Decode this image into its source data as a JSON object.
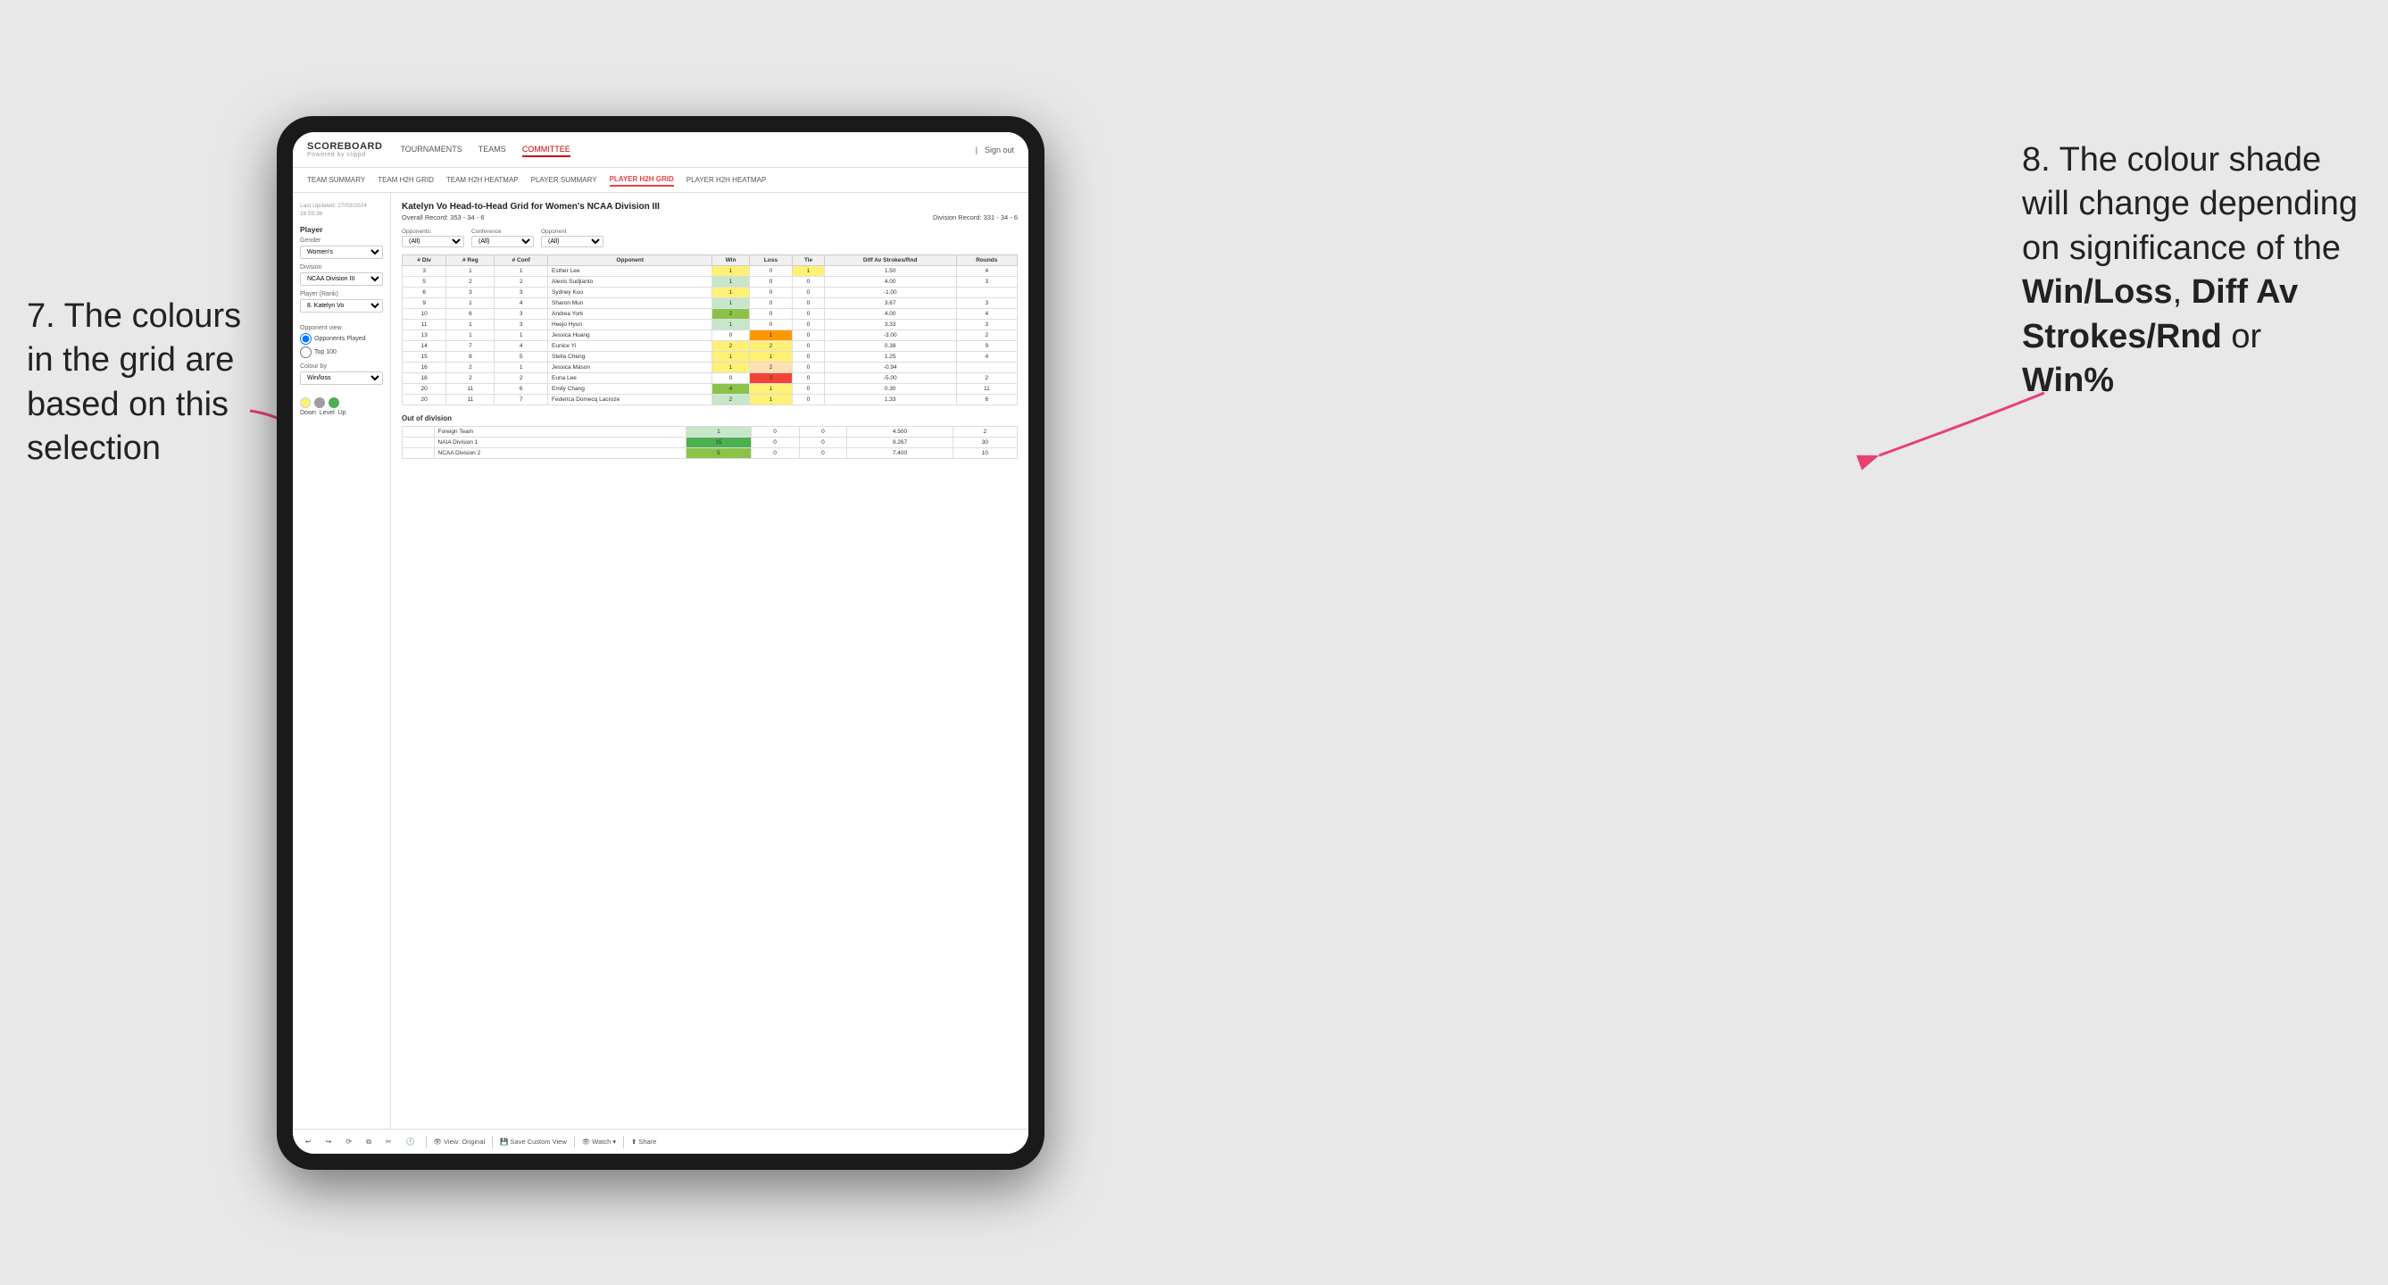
{
  "annotations": {
    "left_title": "7. The colours in the grid are based on this selection",
    "right_title": "8. The colour shade will change depending on significance of the",
    "right_bold1": "Win/Loss",
    "right_comma": ", ",
    "right_bold2": "Diff Av Strokes/Rnd",
    "right_or": " or",
    "right_bold3": "Win%"
  },
  "nav": {
    "logo": "SCOREBOARD",
    "logo_sub": "Powered by clippd",
    "links": [
      "TOURNAMENTS",
      "TEAMS",
      "COMMITTEE"
    ],
    "active_link": "COMMITTEE",
    "right": [
      "Sign out"
    ]
  },
  "subnav": {
    "links": [
      "TEAM SUMMARY",
      "TEAM H2H GRID",
      "TEAM H2H HEATMAP",
      "PLAYER SUMMARY",
      "PLAYER H2H GRID",
      "PLAYER H2H HEATMAP"
    ],
    "active": "PLAYER H2H GRID"
  },
  "sidebar": {
    "updated": "Last Updated: 27/03/2024\n16:55:38",
    "player_section": "Player",
    "gender_label": "Gender",
    "gender_value": "Women's",
    "division_label": "Division",
    "division_value": "NCAA Division III",
    "player_rank_label": "Player (Rank)",
    "player_rank_value": "8. Katelyn Vo",
    "opponent_view_label": "Opponent view",
    "radio_opponents": "Opponents Played",
    "radio_top100": "Top 100",
    "colour_by_label": "Colour by",
    "colour_by_value": "Win/loss",
    "legend_down": "Down",
    "legend_level": "Level",
    "legend_up": "Up"
  },
  "grid": {
    "title": "Katelyn Vo Head-to-Head Grid for Women's NCAA Division III",
    "overall_record": "Overall Record: 353 - 34 - 6",
    "division_record": "Division Record: 331 - 34 - 6",
    "filter_opponents_label": "Opponents:",
    "filter_opponents_value": "(All)",
    "filter_conference_label": "Conference",
    "filter_conference_value": "(All)",
    "filter_opponent_label": "Opponent",
    "filter_opponent_value": "(All)",
    "columns": [
      "# Div",
      "# Reg",
      "# Conf",
      "Opponent",
      "Win",
      "Loss",
      "Tie",
      "Diff Av Strokes/Rnd",
      "Rounds"
    ],
    "rows": [
      {
        "div": 3,
        "reg": 1,
        "conf": 1,
        "opponent": "Esther Lee",
        "win": 1,
        "loss": 0,
        "tie": 1,
        "diff": 1.5,
        "rounds": 4,
        "win_color": "cell-yellow",
        "loss_color": "cell-white",
        "tie_color": "cell-yellow"
      },
      {
        "div": 5,
        "reg": 2,
        "conf": 2,
        "opponent": "Alexis Sudjianto",
        "win": 1,
        "loss": 0,
        "tie": 0,
        "diff": 4.0,
        "rounds": 3,
        "win_color": "cell-green-light",
        "loss_color": "cell-white",
        "tie_color": "cell-white"
      },
      {
        "div": 6,
        "reg": 3,
        "conf": 3,
        "opponent": "Sydney Kuo",
        "win": 1,
        "loss": 0,
        "tie": 0,
        "diff": -1.0,
        "rounds": "",
        "win_color": "cell-yellow",
        "loss_color": "cell-white",
        "tie_color": "cell-white"
      },
      {
        "div": 9,
        "reg": 1,
        "conf": 4,
        "opponent": "Sharon Mun",
        "win": 1,
        "loss": 0,
        "tie": 0,
        "diff": 3.67,
        "rounds": 3,
        "win_color": "cell-green-light",
        "loss_color": "cell-white",
        "tie_color": "cell-white"
      },
      {
        "div": 10,
        "reg": 6,
        "conf": 3,
        "opponent": "Andrea York",
        "win": 2,
        "loss": 0,
        "tie": 0,
        "diff": 4.0,
        "rounds": 4,
        "win_color": "cell-green-med",
        "loss_color": "cell-white",
        "tie_color": "cell-white"
      },
      {
        "div": 11,
        "reg": 1,
        "conf": 3,
        "opponent": "Heejo Hyun",
        "win": 1,
        "loss": 0,
        "tie": 0,
        "diff": 3.33,
        "rounds": 3,
        "win_color": "cell-green-light",
        "loss_color": "cell-white",
        "tie_color": "cell-white"
      },
      {
        "div": 13,
        "reg": 1,
        "conf": 1,
        "opponent": "Jessica Huang",
        "win": 0,
        "loss": 1,
        "tie": 0,
        "diff": -3.0,
        "rounds": 2,
        "win_color": "cell-white",
        "loss_color": "cell-orange",
        "tie_color": "cell-white"
      },
      {
        "div": 14,
        "reg": 7,
        "conf": 4,
        "opponent": "Eunice Yi",
        "win": 2,
        "loss": 2,
        "tie": 0,
        "diff": 0.38,
        "rounds": 9,
        "win_color": "cell-yellow",
        "loss_color": "cell-yellow",
        "tie_color": "cell-white"
      },
      {
        "div": 15,
        "reg": 8,
        "conf": 5,
        "opponent": "Stella Cheng",
        "win": 1,
        "loss": 1,
        "tie": 0,
        "diff": 1.25,
        "rounds": 4,
        "win_color": "cell-yellow",
        "loss_color": "cell-yellow",
        "tie_color": "cell-white"
      },
      {
        "div": 16,
        "reg": 2,
        "conf": 1,
        "opponent": "Jessica Mason",
        "win": 1,
        "loss": 2,
        "tie": 0,
        "diff": -0.94,
        "rounds": "",
        "win_color": "cell-yellow",
        "loss_color": "cell-orange-light",
        "tie_color": "cell-white"
      },
      {
        "div": 18,
        "reg": 2,
        "conf": 2,
        "opponent": "Euna Lee",
        "win": 0,
        "loss": 3,
        "tie": 0,
        "diff": -5.0,
        "rounds": 2,
        "win_color": "cell-white",
        "loss_color": "cell-red",
        "tie_color": "cell-white"
      },
      {
        "div": 20,
        "reg": 11,
        "conf": 6,
        "opponent": "Emily Chang",
        "win": 4,
        "loss": 1,
        "tie": 0,
        "diff": 0.3,
        "rounds": 11,
        "win_color": "cell-green-med",
        "loss_color": "cell-yellow",
        "tie_color": "cell-white"
      },
      {
        "div": 20,
        "reg": 11,
        "conf": 7,
        "opponent": "Federica Domecq Lacroze",
        "win": 2,
        "loss": 1,
        "tie": 0,
        "diff": 1.33,
        "rounds": 6,
        "win_color": "cell-green-light",
        "loss_color": "cell-yellow",
        "tie_color": "cell-white"
      }
    ],
    "out_of_division_title": "Out of division",
    "out_of_division_rows": [
      {
        "name": "Foreign Team",
        "win": 1,
        "loss": 0,
        "tie": 0,
        "diff": 4.5,
        "rounds": 2,
        "win_color": "cell-green-light",
        "loss_color": "cell-white",
        "tie_color": "cell-white"
      },
      {
        "name": "NAIA Division 1",
        "win": 15,
        "loss": 0,
        "tie": 0,
        "diff": 9.267,
        "rounds": 30,
        "win_color": "cell-green-dark",
        "loss_color": "cell-white",
        "tie_color": "cell-white"
      },
      {
        "name": "NCAA Division 2",
        "win": 5,
        "loss": 0,
        "tie": 0,
        "diff": 7.4,
        "rounds": 10,
        "win_color": "cell-green-med",
        "loss_color": "cell-white",
        "tie_color": "cell-white"
      }
    ]
  },
  "toolbar": {
    "view_original": "View: Original",
    "save_custom": "Save Custom View",
    "watch": "Watch",
    "share": "Share"
  },
  "legend": {
    "yellow": "#fff176",
    "gray": "#9e9e9e",
    "green": "#4caf50"
  }
}
